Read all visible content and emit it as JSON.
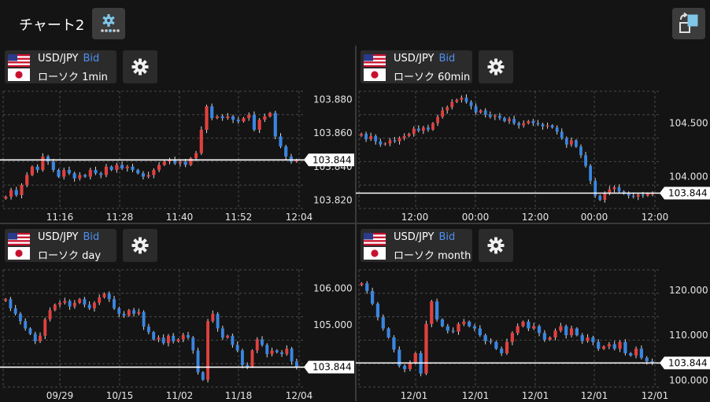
{
  "header": {
    "title": "チャート2"
  },
  "colors": {
    "up": "#e0413e",
    "down": "#3a86e0",
    "bid": "#4e8ff0",
    "price_line": "#ffffff"
  },
  "panels": [
    {
      "symbol": "USD/JPY",
      "bid_label": "Bid",
      "chart_type": "ローソク 1min",
      "y_ticks": [
        "103.880",
        "103.860",
        "103.840",
        "103.820"
      ],
      "x_ticks": [
        "11:16",
        "11:28",
        "11:40",
        "11:52",
        "12:04"
      ],
      "current_price": "103.844"
    },
    {
      "symbol": "USD/JPY",
      "bid_label": "Bid",
      "chart_type": "ローソク 60min",
      "y_ticks": [
        "104.500",
        "104.000"
      ],
      "x_ticks": [
        "12:00",
        "00:00",
        "12:00",
        "00:00",
        "12:00"
      ],
      "current_price": "103.844"
    },
    {
      "symbol": "USD/JPY",
      "bid_label": "Bid",
      "chart_type": "ローソク day",
      "y_ticks": [
        "106.000",
        "105.000"
      ],
      "x_ticks": [
        "09/29",
        "10/15",
        "11/02",
        "11/18",
        "12/04"
      ],
      "current_price": "103.844"
    },
    {
      "symbol": "USD/JPY",
      "bid_label": "Bid",
      "chart_type": "ローソク month",
      "y_ticks": [
        "120.000",
        "110.000",
        "100.000"
      ],
      "x_ticks": [
        "12/01",
        "12/01",
        "12/01",
        "12/01",
        "12/01"
      ],
      "current_price": "103.844"
    }
  ],
  "chart_data": [
    {
      "type": "candlestick",
      "series_name": "USD/JPY Bid 1min",
      "ylim": [
        103.815,
        103.885
      ],
      "y_ticks": [
        103.88,
        103.86,
        103.84,
        103.82
      ],
      "x_ticks": [
        "11:16",
        "11:28",
        "11:40",
        "11:52",
        "12:04"
      ],
      "current_price": 103.844,
      "close": [
        103.822,
        103.826,
        103.823,
        103.829,
        103.835,
        103.84,
        103.838,
        103.846,
        103.843,
        103.838,
        103.834,
        103.838,
        103.836,
        103.833,
        103.835,
        103.834,
        103.838,
        103.836,
        103.835,
        103.84,
        103.838,
        103.841,
        103.839,
        103.84,
        103.838,
        103.836,
        103.834,
        103.835,
        103.838,
        103.841,
        103.843,
        103.844,
        103.842,
        103.843,
        103.841,
        103.845,
        103.848,
        103.862,
        103.876,
        103.869,
        103.87,
        103.869,
        103.87,
        103.868,
        103.867,
        103.869,
        103.871,
        103.862,
        103.868,
        103.87,
        103.872,
        103.858,
        103.852,
        103.846,
        103.843,
        103.844
      ]
    },
    {
      "type": "candlestick",
      "series_name": "USD/JPY Bid 60min",
      "ylim": [
        103.7,
        104.8
      ],
      "y_ticks": [
        104.5,
        104.0
      ],
      "x_ticks": [
        "12:00",
        "00:00",
        "12:00",
        "00:00",
        "12:00"
      ],
      "current_price": 103.844,
      "close": [
        104.4,
        104.35,
        104.38,
        104.33,
        104.3,
        104.31,
        104.34,
        104.33,
        104.36,
        104.38,
        104.4,
        104.45,
        104.43,
        104.46,
        104.44,
        104.5,
        104.56,
        104.62,
        104.65,
        104.7,
        104.72,
        104.74,
        104.7,
        104.66,
        104.6,
        104.62,
        104.58,
        104.56,
        104.57,
        104.55,
        104.52,
        104.54,
        104.5,
        104.48,
        104.5,
        104.52,
        104.5,
        104.49,
        104.47,
        104.48,
        104.46,
        104.42,
        104.36,
        104.3,
        104.34,
        104.28,
        104.2,
        104.1,
        103.96,
        103.82,
        103.78,
        103.84,
        103.88,
        103.9,
        103.86,
        103.84,
        103.82,
        103.81,
        103.83,
        103.82,
        103.84,
        103.84
      ]
    },
    {
      "type": "candlestick",
      "series_name": "USD/JPY Bid day",
      "ylim": [
        103.3,
        106.5
      ],
      "y_ticks": [
        106.0,
        105.0
      ],
      "x_ticks": [
        "09/29",
        "10/15",
        "11/02",
        "11/18",
        "12/04"
      ],
      "current_price": 103.844,
      "close": [
        105.7,
        105.45,
        105.3,
        105.1,
        104.9,
        104.75,
        104.55,
        104.7,
        105.15,
        105.4,
        105.55,
        105.6,
        105.65,
        105.5,
        105.6,
        105.7,
        105.55,
        105.45,
        105.6,
        105.75,
        105.85,
        105.7,
        105.45,
        105.3,
        105.25,
        105.4,
        105.3,
        105.35,
        104.95,
        104.8,
        104.6,
        104.65,
        104.5,
        104.7,
        104.55,
        104.6,
        104.72,
        104.65,
        104.3,
        103.7,
        103.5,
        105.1,
        105.3,
        104.9,
        104.65,
        104.7,
        104.45,
        104.3,
        103.9,
        103.85,
        104.3,
        104.6,
        104.45,
        104.2,
        104.3,
        104.25,
        104.2,
        104.35,
        104.0,
        103.84
      ]
    },
    {
      "type": "candlestick",
      "series_name": "USD/JPY Bid month",
      "ylim": [
        98.5,
        124.5
      ],
      "y_ticks": [
        120.0,
        110.0,
        100.0
      ],
      "x_ticks": [
        "12/01",
        "12/01",
        "12/01",
        "12/01",
        "12/01"
      ],
      "current_price": 103.844,
      "close": [
        121.5,
        119.8,
        117.0,
        114.0,
        111.5,
        109.5,
        106.8,
        103.2,
        102.5,
        103.8,
        106.0,
        101.5,
        112.5,
        117.5,
        113.5,
        112.0,
        111.0,
        110.8,
        112.5,
        113.0,
        112.0,
        111.5,
        110.0,
        108.7,
        108.5,
        107.0,
        106.0,
        108.5,
        110.5,
        112.0,
        113.0,
        111.5,
        112.0,
        110.5,
        109.0,
        109.5,
        111.0,
        112.0,
        110.0,
        111.5,
        110.0,
        108.7,
        109.5,
        108.5,
        107.0,
        107.5,
        108.0,
        107.0,
        108.5,
        106.0,
        105.5,
        107.0,
        105.0,
        104.2,
        103.84
      ]
    }
  ]
}
